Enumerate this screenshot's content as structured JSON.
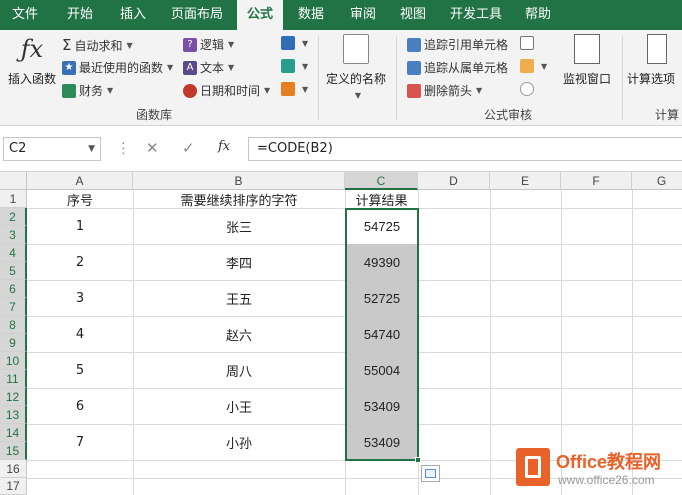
{
  "tabs": [
    "文件",
    "开始",
    "插入",
    "页面布局",
    "公式",
    "数据",
    "审阅",
    "视图",
    "开发工具",
    "帮助"
  ],
  "active_tab": "公式",
  "ribbon": {
    "insert_function": "插入函数",
    "autosum": "自动求和",
    "recent": "最近使用的函数",
    "finance": "财务",
    "logic": "逻辑",
    "text": "文本",
    "datetime": "日期和时间",
    "library_group": "函数库",
    "defined_names": "定义的名称",
    "trace_precedents": "追踪引用单元格",
    "trace_dependents": "追踪从属单元格",
    "remove_arrows": "删除箭头",
    "audit_group": "公式审核",
    "watch_window": "监视窗口",
    "calc_options": "计算选项",
    "calc_group": "计算"
  },
  "formula_bar": {
    "name_box": "C2",
    "formula": "=CODE(B2)",
    "fx": "fx"
  },
  "columns": [
    "A",
    "B",
    "C",
    "D",
    "E",
    "F",
    "G"
  ],
  "rows": [
    "1",
    "2",
    "3",
    "4",
    "5",
    "6",
    "7",
    "8",
    "9",
    "10",
    "11",
    "12",
    "13",
    "14",
    "15",
    "16",
    "17"
  ],
  "headers": {
    "a": "序号",
    "b": "需要继续排序的字符",
    "c": "计算结果"
  },
  "table": [
    {
      "no": "1",
      "name": "张三",
      "result": "54725"
    },
    {
      "no": "2",
      "name": "李四",
      "result": "49390"
    },
    {
      "no": "3",
      "name": "王五",
      "result": "52725"
    },
    {
      "no": "4",
      "name": "赵六",
      "result": "54740"
    },
    {
      "no": "5",
      "name": "周八",
      "result": "55004"
    },
    {
      "no": "6",
      "name": "小王",
      "result": "53409"
    },
    {
      "no": "7",
      "name": "小孙",
      "result": "53409"
    }
  ],
  "watermark": {
    "title": "Office教程网",
    "url": "www.office26.com"
  },
  "colors": {
    "accent": "#217346",
    "selection_shade": "#c9c9c9",
    "watermark": "#e8622a"
  }
}
